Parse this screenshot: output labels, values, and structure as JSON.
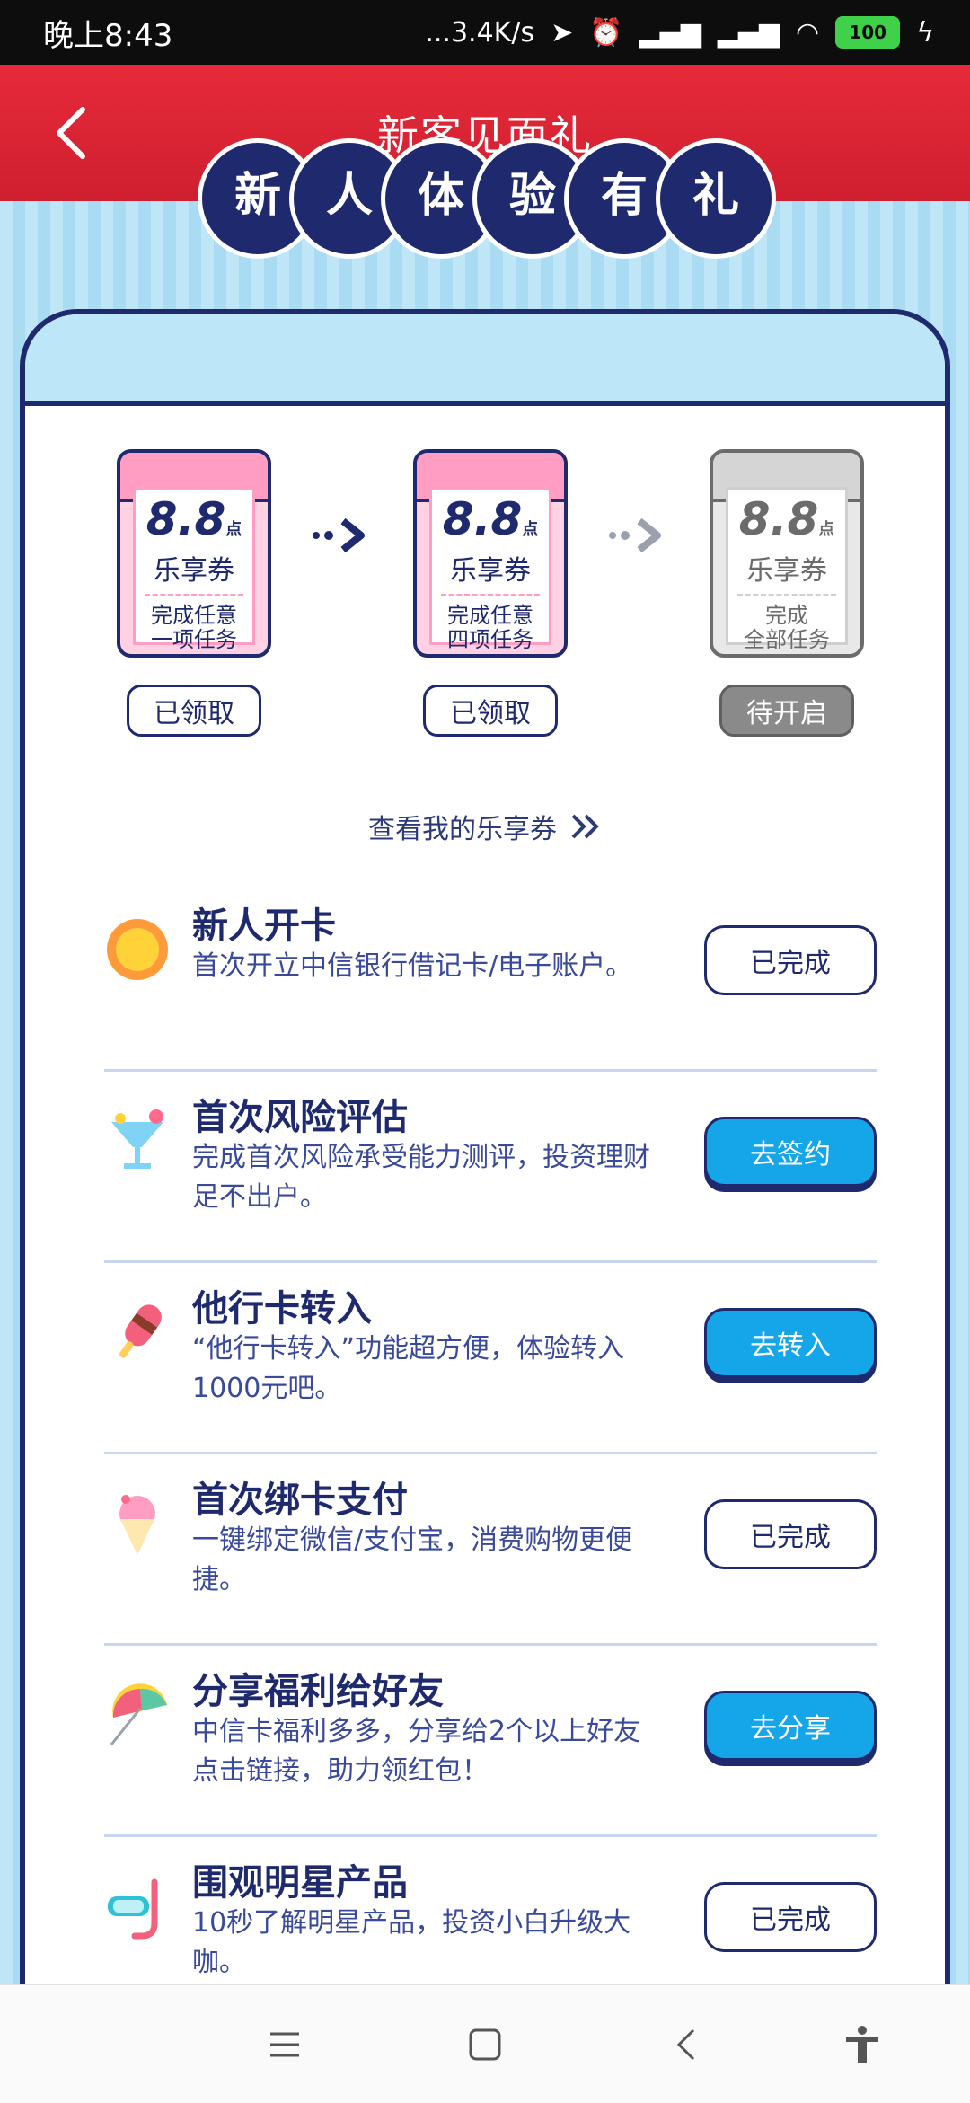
{
  "status_bar": {
    "time": "晚上8:43",
    "network_speed": "...3.4K/s",
    "battery": "100"
  },
  "header": {
    "title": "新客见面礼"
  },
  "banner": {
    "chars": [
      "新",
      "人",
      "体",
      "验",
      "有",
      "礼"
    ]
  },
  "coupons": [
    {
      "amount": "8.8",
      "unit": "点",
      "name": "乐享券",
      "cond_line1": "完成任意",
      "cond_line2": "一项任务",
      "status": "已领取",
      "active": true
    },
    {
      "amount": "8.8",
      "unit": "点",
      "name": "乐享券",
      "cond_line1": "完成任意",
      "cond_line2": "四项任务",
      "status": "已领取",
      "active": true
    },
    {
      "amount": "8.8",
      "unit": "点",
      "name": "乐享券",
      "cond_line1": "完成",
      "cond_line2": "全部任务",
      "status": "待开启",
      "active": false
    }
  ],
  "view_link": "查看我的乐享券",
  "tasks": [
    {
      "title": "新人开卡",
      "desc": "首次开立中信银行借记卡/电子账户。",
      "button": "已完成",
      "done": true,
      "icon": "sun-icon"
    },
    {
      "title": "首次风险评估",
      "desc": "完成首次风险承受能力测评，投资理财足不出户。",
      "button": "去签约",
      "done": false,
      "icon": "cocktail-icon"
    },
    {
      "title": "他行卡转入",
      "desc": "“他行卡转入”功能超方便，体验转入1000元吧。",
      "button": "去转入",
      "done": false,
      "icon": "popsicle-icon"
    },
    {
      "title": "首次绑卡支付",
      "desc": "一键绑定微信/支付宝，消费购物更便捷。",
      "button": "已完成",
      "done": true,
      "icon": "ice-cream-icon"
    },
    {
      "title": "分享福利给好友",
      "desc": "中信卡福利多多，分享给2个以上好友点击链接，助力领红包！",
      "button": "去分享",
      "done": false,
      "icon": "umbrella-icon"
    },
    {
      "title": "围观明星产品",
      "desc": "10秒了解明星产品，投资小白升级大咖。",
      "button": "已完成",
      "done": true,
      "icon": "snorkel-icon"
    }
  ],
  "colors": {
    "header_red": "#e62a3a",
    "navy": "#1e2a6d",
    "accent_blue": "#14a6e8",
    "coupon_pink": "#ff9ec2"
  }
}
